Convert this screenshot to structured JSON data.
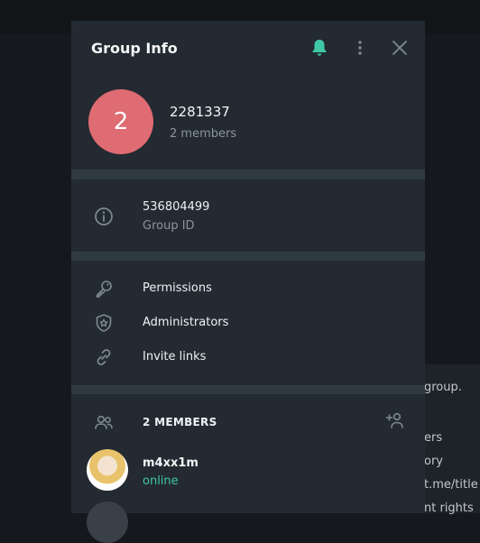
{
  "background": {
    "snippets": [
      "group.",
      "ers",
      "ory",
      "t.me/title",
      "nt rights"
    ]
  },
  "dialog": {
    "title": "Group Info",
    "icons": {
      "notifications": "bell-icon",
      "more": "more-vertical-icon",
      "close": "close-icon"
    }
  },
  "group": {
    "avatar_letter": "2",
    "avatar_color": "#df6b73",
    "name": "2281337",
    "member_count_text": "2 members"
  },
  "info": {
    "value": "536804499",
    "label": "Group ID"
  },
  "menu": {
    "items": [
      {
        "label": "Permissions",
        "icon": "key-icon"
      },
      {
        "label": "Administrators",
        "icon": "shield-star-icon"
      },
      {
        "label": "Invite links",
        "icon": "link-icon"
      }
    ]
  },
  "members": {
    "header": "2 MEMBERS",
    "list": [
      {
        "name": "m4xx1m",
        "status": "online",
        "status_color": "#3fc7a8"
      }
    ]
  },
  "colors": {
    "accent": "#3fc7a8",
    "panel": "#232a31",
    "divider": "#303a43"
  }
}
